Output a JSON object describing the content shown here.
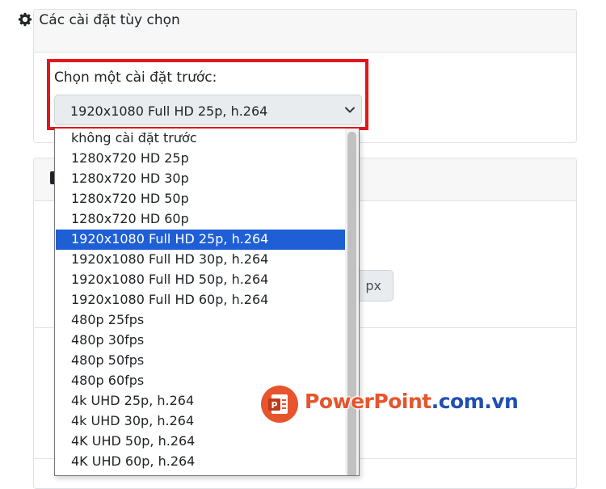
{
  "settings_card": {
    "title": "Các cài đặt tùy chọn",
    "preset_label": "Chọn một cài đặt trước:",
    "preset_select": {
      "selected": "1920x1080 Full HD 25p, h.264"
    }
  },
  "dropdown": {
    "options": [
      "không cài đặt trước",
      "1280x720 HD 25p",
      "1280x720 HD 30p",
      "1280x720 HD 50p",
      "1280x720 HD 60p",
      "1920x1080 Full HD 25p, h.264",
      "1920x1080 Full HD 30p, h.264",
      "1920x1080 Full HD 50p, h.264",
      "1920x1080 Full HD 60p, h.264",
      "480p 25fps",
      "480p 30fps",
      "480p 50fps",
      "480p 60fps",
      "4k UHD 25p, h.264",
      "4k UHD 30p, h.264",
      "4K UHD 50p, h.264",
      "4K UHD 60p, h.264"
    ],
    "selected_index": 5
  },
  "dimension_input": {
    "unit": "px"
  },
  "watermark": {
    "brand": "PowerPoint",
    "domain": ".com.vn"
  },
  "colors": {
    "highlight_border": "#e6141b",
    "selected_option": "#1f5fd6",
    "logo_orange": "#e6552d",
    "logo_blue": "#1f4fb4"
  }
}
